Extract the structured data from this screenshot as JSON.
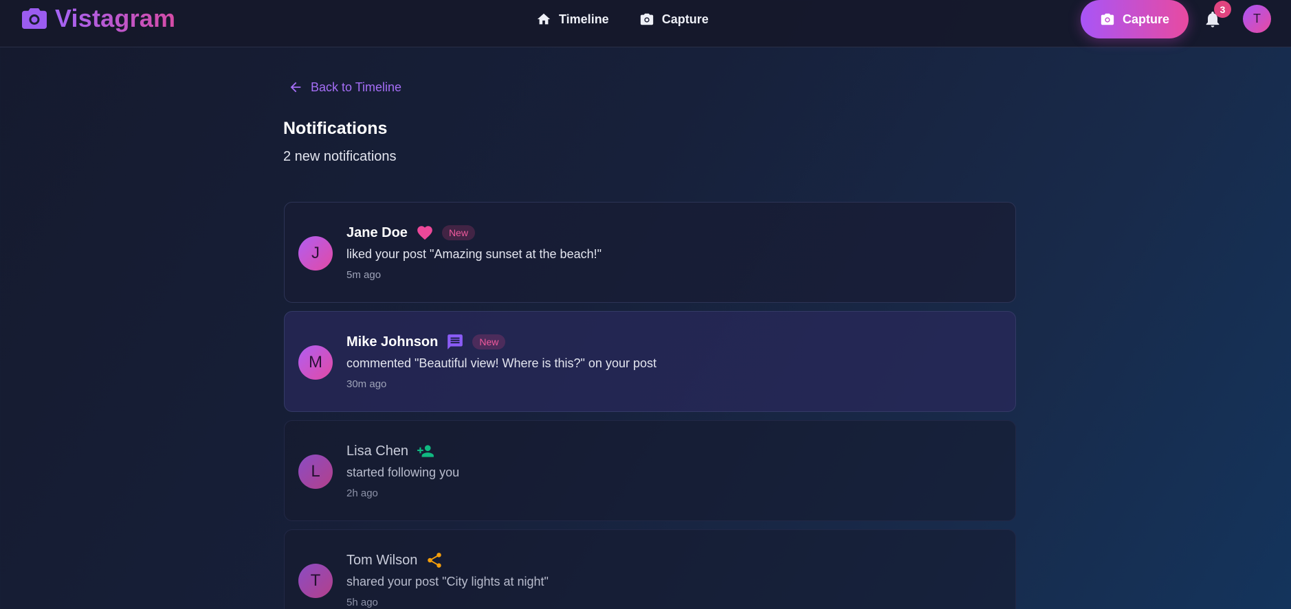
{
  "app": {
    "name": "Vistagram",
    "logo_icon": "camera-icon"
  },
  "header": {
    "nav": [
      {
        "label": "Timeline",
        "icon": "home-icon"
      },
      {
        "label": "Capture",
        "icon": "camera-icon"
      }
    ],
    "capture_button": {
      "label": "Capture",
      "icon": "camera-icon"
    },
    "notification_count": "3",
    "user_initial": "T"
  },
  "page": {
    "back_label": "Back to Timeline",
    "title": "Notifications",
    "subtitle": "2 new notifications"
  },
  "notifications": [
    {
      "initial": "J",
      "name": "Jane Doe",
      "type_icon": "heart-icon",
      "icon_color": "#ec4899",
      "badge": "New",
      "text": "liked your post \"Amazing sunset at the beach!\"",
      "time": "5m ago",
      "unread": true
    },
    {
      "initial": "M",
      "name": "Mike Johnson",
      "type_icon": "comment-icon",
      "icon_color": "#8b5cf6",
      "badge": "New",
      "text": "commented \"Beautiful view! Where is this?\" on your post",
      "time": "30m ago",
      "unread": true
    },
    {
      "initial": "L",
      "name": "Lisa Chen",
      "type_icon": "person-add-icon",
      "icon_color": "#10b981",
      "badge": "",
      "text": "started following you",
      "time": "2h ago",
      "unread": false
    },
    {
      "initial": "T",
      "name": "Tom Wilson",
      "type_icon": "share-icon",
      "icon_color": "#f59e0b",
      "badge": "",
      "text": "shared your post \"City lights at night\"",
      "time": "5h ago",
      "unread": false
    }
  ],
  "colors": {
    "accent_purple": "#a855f7",
    "accent_pink": "#e84aa0",
    "badge_pink": "#e0447f"
  }
}
